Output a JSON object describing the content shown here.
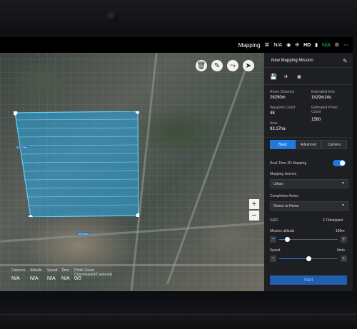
{
  "statusbar": {
    "mode": "Mapping",
    "signal1": "N/A",
    "hd": "HD",
    "signal2": "N/A"
  },
  "map": {
    "distance_label_1": "215.70m",
    "distance_label_2": "309.54m",
    "zoom_in": "+",
    "zoom_out": "−",
    "bottom_stats": {
      "labels": [
        "Distance",
        "Altitude",
        "Speed",
        "Time",
        "Photo Count (Downloaded/Captured)"
      ],
      "values": [
        "N/A",
        "N/A",
        "N/A",
        "N/A",
        "0/0"
      ]
    }
  },
  "panel": {
    "title": "New Mapping Mission",
    "route_distance_label": "Route Distance",
    "route_distance_value": "26290m",
    "estimated_time_label": "Estimated time",
    "estimated_time_value": "1h29m24s",
    "waypoint_count_label": "Waypoint Count",
    "waypoint_count_value": "48",
    "estimated_photo_label": "Estimated Photo Count",
    "estimated_photo_value": "1560",
    "area_label": "Area",
    "area_value": "93.17ha",
    "tabs": [
      "Basic",
      "Advanced",
      "Camera"
    ],
    "realtime_label": "Real-Time 2D Mapping",
    "realtime_on": true,
    "scenes_label": "Mapping Scenes",
    "scenes_value": "Urban",
    "completion_label": "Completion Action",
    "completion_value": "Return to Home",
    "gsd_label": "GSD",
    "gsd_value": "2.74cm/pixel",
    "altitude_label": "Mission altitude",
    "altitude_value": "100m",
    "altitude_fraction": 0.14,
    "speed_label": "Speed",
    "speed_value": "5m/s",
    "speed_fraction": 0.5,
    "start_label": "Start"
  },
  "colors": {
    "accent": "#1f7ae0",
    "panel_bg": "#1e1f22",
    "mission_fill": "#2aa8e6"
  }
}
